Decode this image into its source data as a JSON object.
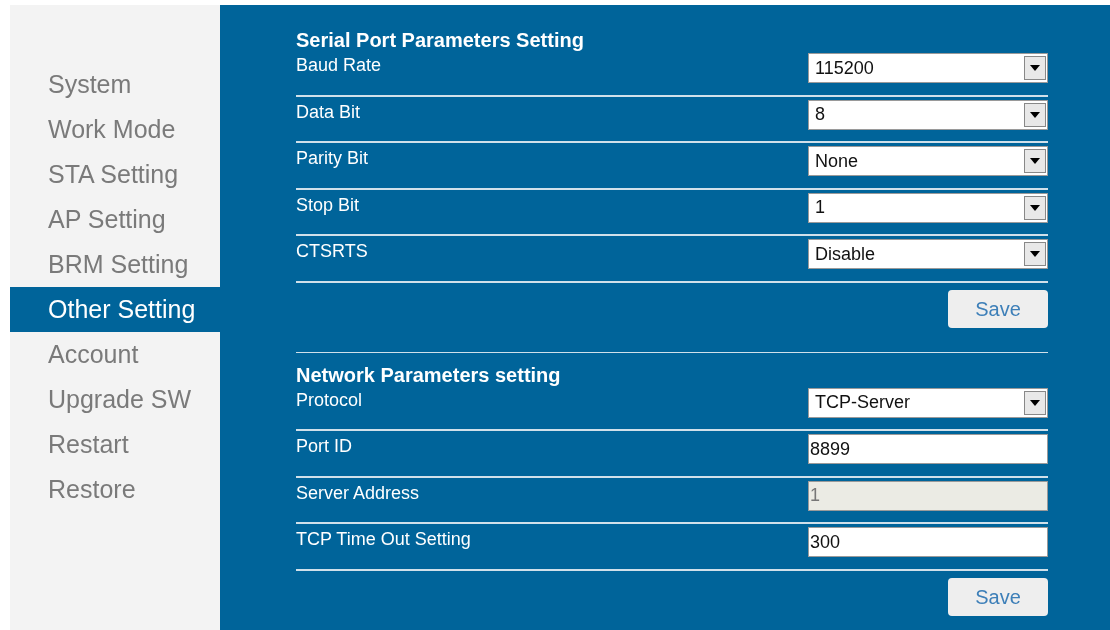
{
  "sidebar": {
    "items": [
      {
        "label": "System",
        "selected": false
      },
      {
        "label": "Work Mode",
        "selected": false
      },
      {
        "label": "STA Setting",
        "selected": false
      },
      {
        "label": "AP Setting",
        "selected": false
      },
      {
        "label": "BRM Setting",
        "selected": false
      },
      {
        "label": "Other Setting",
        "selected": true
      },
      {
        "label": "Account",
        "selected": false
      },
      {
        "label": "Upgrade SW",
        "selected": false
      },
      {
        "label": "Restart",
        "selected": false
      },
      {
        "label": "Restore",
        "selected": false
      }
    ]
  },
  "sections": [
    {
      "title": "Serial Port Parameters Setting",
      "fields": [
        {
          "label": "Baud Rate",
          "kind": "select",
          "value": "115200",
          "disabled": false
        },
        {
          "label": "Data Bit",
          "kind": "select",
          "value": "8",
          "disabled": false
        },
        {
          "label": "Parity Bit",
          "kind": "select",
          "value": "None",
          "disabled": false
        },
        {
          "label": "Stop Bit",
          "kind": "select",
          "value": "1",
          "disabled": false
        },
        {
          "label": "CTSRTS",
          "kind": "select",
          "value": "Disable",
          "disabled": false
        }
      ],
      "button": "Save"
    },
    {
      "title": "Network Parameters setting",
      "fields": [
        {
          "label": "Protocol",
          "kind": "select",
          "value": "TCP-Server",
          "disabled": false
        },
        {
          "label": "Port ID",
          "kind": "text",
          "value": "8899",
          "disabled": false
        },
        {
          "label": "Server Address",
          "kind": "text",
          "value": "1",
          "disabled": true
        },
        {
          "label": "TCP Time Out Setting",
          "kind": "text",
          "value": "300",
          "disabled": false
        }
      ],
      "button": "Save"
    }
  ]
}
